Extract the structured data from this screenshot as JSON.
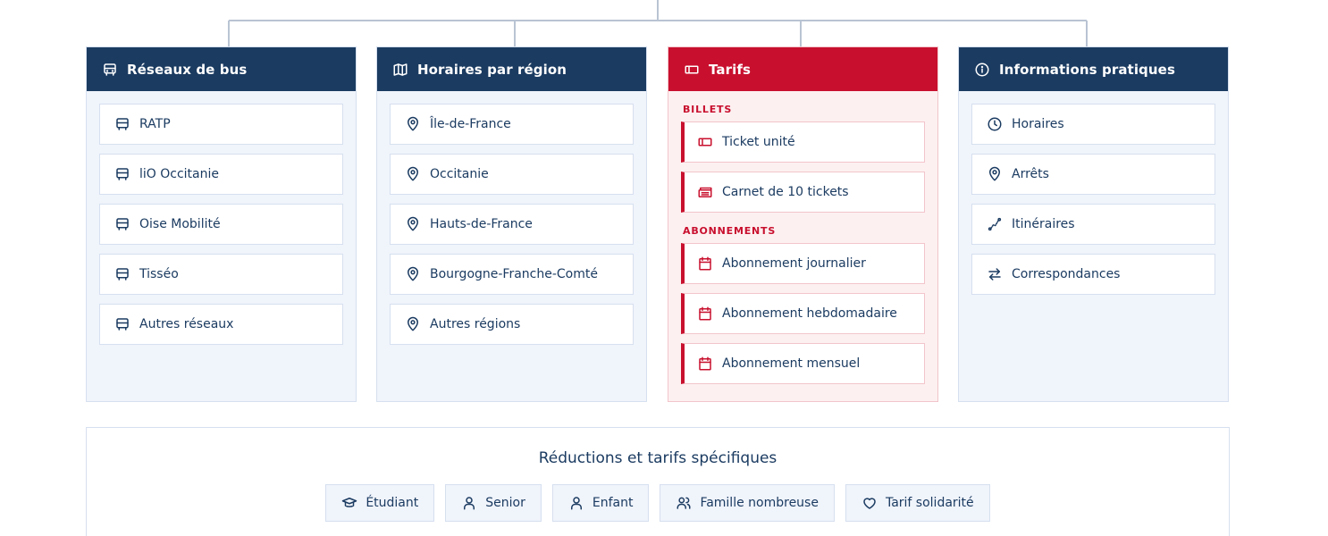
{
  "columns": [
    {
      "title": "Réseaux de bus",
      "icon": "bus-icon",
      "items": [
        {
          "label": "RATP",
          "icon": "bus-icon"
        },
        {
          "label": "liO Occitanie",
          "icon": "bus-icon"
        },
        {
          "label": "Oise Mobilité",
          "icon": "bus-icon"
        },
        {
          "label": "Tisséo",
          "icon": "bus-icon"
        },
        {
          "label": "Autres réseaux",
          "icon": "bus-icon"
        }
      ]
    },
    {
      "title": "Horaires par région",
      "icon": "map-icon",
      "items": [
        {
          "label": "Île-de-France",
          "icon": "map-pin-icon"
        },
        {
          "label": "Occitanie",
          "icon": "map-pin-icon"
        },
        {
          "label": "Hauts-de-France",
          "icon": "map-pin-icon"
        },
        {
          "label": "Bourgogne-Franche-Comté",
          "icon": "map-pin-icon"
        },
        {
          "label": "Autres régions",
          "icon": "map-pin-icon"
        }
      ]
    },
    {
      "title": "Tarifs",
      "icon": "ticket-icon",
      "sections": [
        {
          "heading": "BILLETS",
          "items": [
            {
              "label": "Ticket unité",
              "icon": "ticket-icon"
            },
            {
              "label": "Carnet de 10 tickets",
              "icon": "tickets-icon"
            }
          ]
        },
        {
          "heading": "ABONNEMENTS",
          "items": [
            {
              "label": "Abonnement journalier",
              "icon": "calendar-icon"
            },
            {
              "label": "Abonnement hebdomadaire",
              "icon": "calendar-icon"
            },
            {
              "label": "Abonnement mensuel",
              "icon": "calendar-icon"
            }
          ]
        }
      ]
    },
    {
      "title": "Informations pratiques",
      "icon": "info-icon",
      "items": [
        {
          "label": "Horaires",
          "icon": "clock-icon"
        },
        {
          "label": "Arrêts",
          "icon": "map-pin-icon"
        },
        {
          "label": "Itinéraires",
          "icon": "route-icon"
        },
        {
          "label": "Correspondances",
          "icon": "arrows-swap-icon"
        }
      ]
    }
  ],
  "reductions": {
    "title": "Réductions et tarifs spécifiques",
    "items": [
      {
        "label": "Étudiant",
        "icon": "graduation-cap-icon"
      },
      {
        "label": "Senior",
        "icon": "user-icon"
      },
      {
        "label": "Enfant",
        "icon": "user-icon"
      },
      {
        "label": "Famille nombreuse",
        "icon": "users-icon"
      },
      {
        "label": "Tarif solidarité",
        "icon": "heart-icon"
      }
    ]
  },
  "colors": {
    "navy": "#1b3b61",
    "red": "#c8102e",
    "panel_bg": "#f0f4fb",
    "panel_red_bg": "#fdf0f1"
  }
}
